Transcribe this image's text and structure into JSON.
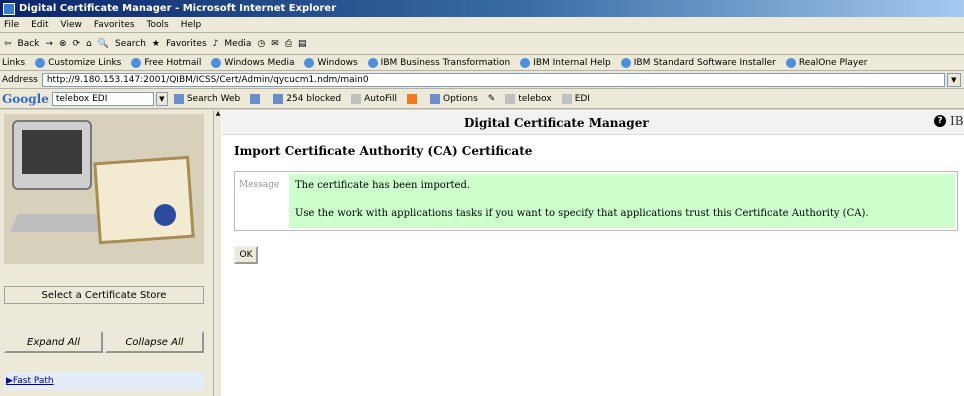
{
  "window": {
    "title": "Digital Certificate Manager - Microsoft Internet Explorer"
  },
  "menu": [
    "File",
    "Edit",
    "View",
    "Favorites",
    "Tools",
    "Help"
  ],
  "toolbar": {
    "back": "Back",
    "search": "Search",
    "favorites": "Favorites",
    "media": "Media"
  },
  "links": {
    "label": "Links",
    "items": [
      "Customize Links",
      "Free Hotmail",
      "Windows Media",
      "Windows",
      "IBM Business Transformation",
      "IBM Internal Help",
      "IBM Standard Software Installer",
      "RealOne Player"
    ]
  },
  "address": {
    "label": "Address",
    "url": "http://9.180.153.147:2001/QIBM/ICSS/Cert/Admin/qycucm1.ndm/main0"
  },
  "google": {
    "logo": "Google",
    "query": "telebox EDI",
    "search_web": "Search Web",
    "blocked": "254 blocked",
    "autofill": "AutoFill",
    "options": "Options",
    "term1": "telebox",
    "term2": "EDI"
  },
  "sidebar": {
    "select_store": "Select a Certificate Store",
    "expand_all": "Expand All",
    "collapse_all": "Collapse All",
    "first_link": "Fast Path"
  },
  "header": {
    "app_title": "Digital Certificate Manager",
    "brand": "IB"
  },
  "main": {
    "title": "Import Certificate Authority (CA) Certificate",
    "message_label": "Message",
    "message_line1": "The certificate has been imported.",
    "message_line2": "Use the work with applications tasks if you want to specify that applications trust this Certificate Authority (CA).",
    "ok_label": "OK"
  },
  "colors": {
    "message_bg": "#ccffcc",
    "title_bar": "#0a246a"
  }
}
